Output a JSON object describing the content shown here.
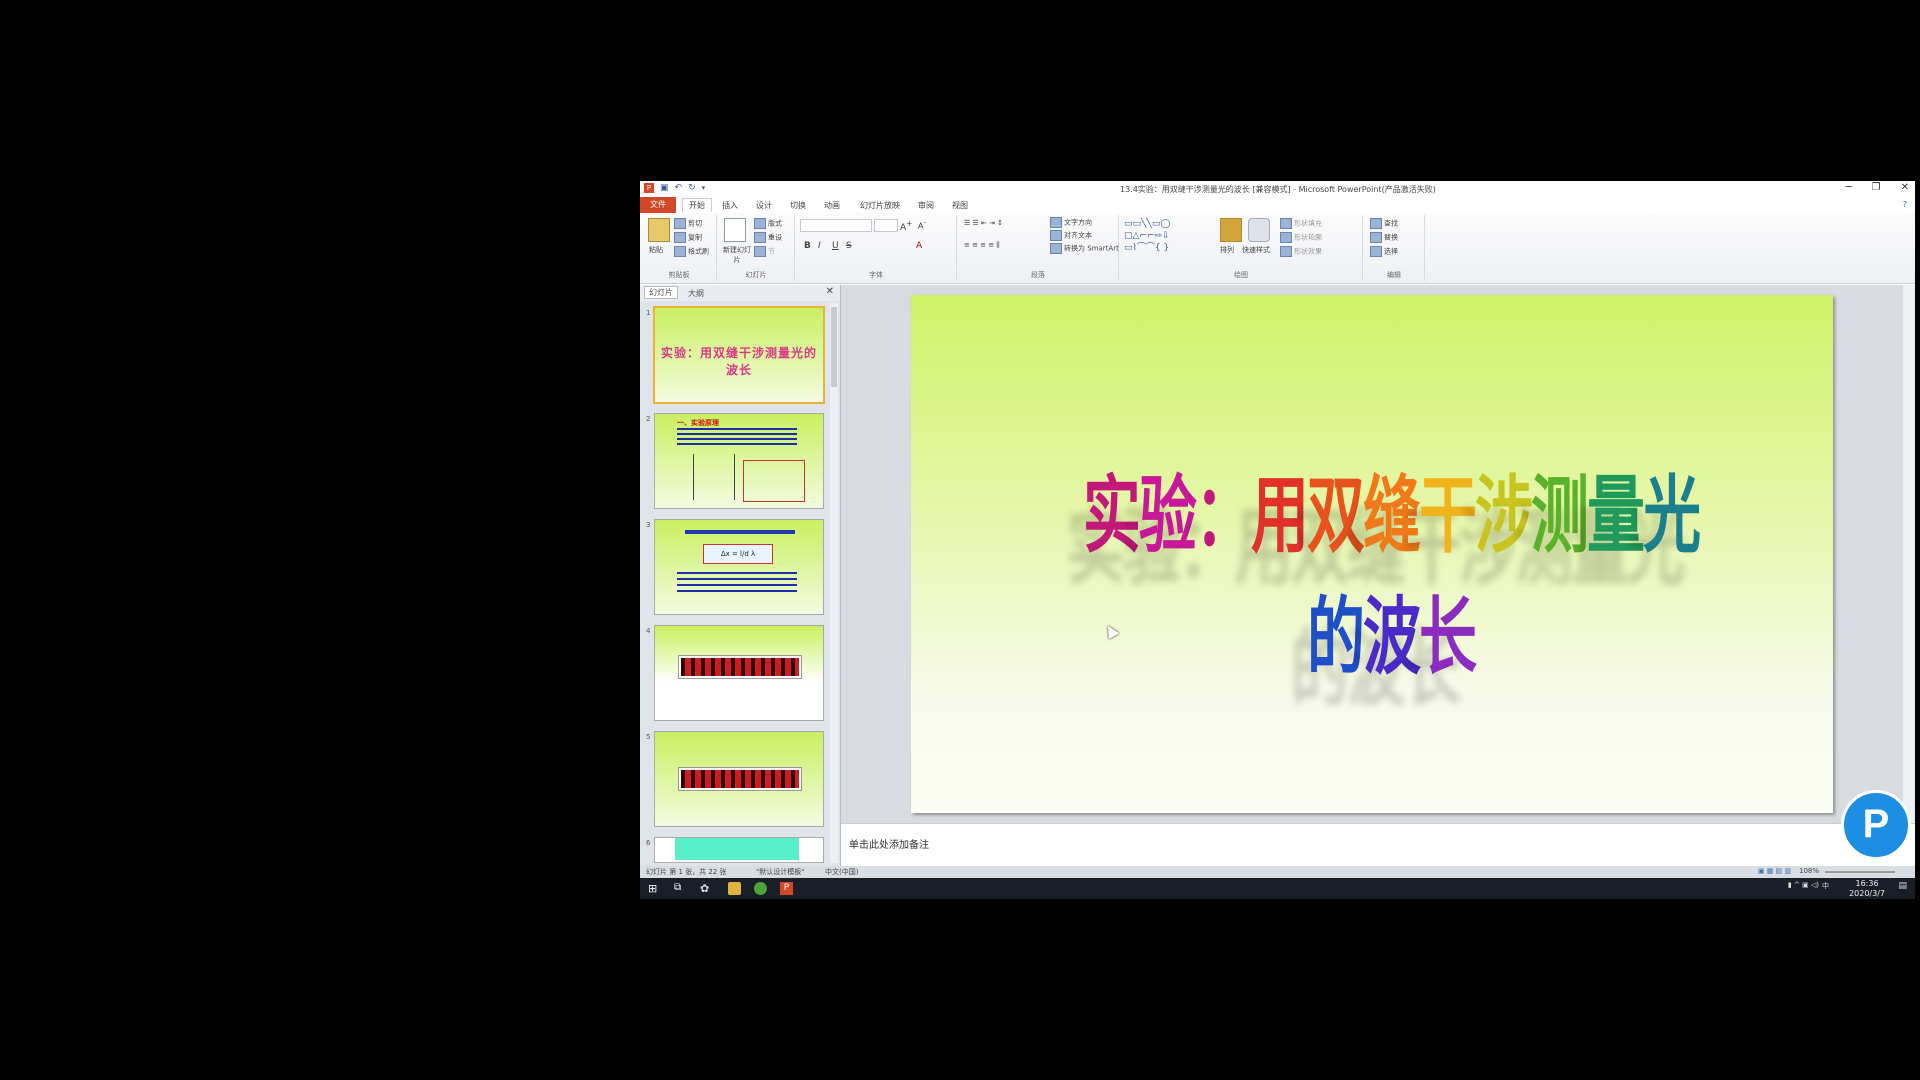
{
  "window": {
    "title": "13.4实验：用双缝干涉测量光的波长 [兼容模式] - Microsoft PowerPoint(产品激活失败)",
    "controls": {
      "minimize": "─",
      "restore": "❐",
      "close": "✕"
    }
  },
  "ribbon_tabs": [
    "文件",
    "开始",
    "插入",
    "设计",
    "切换",
    "动画",
    "幻灯片放映",
    "审阅",
    "视图"
  ],
  "ribbon": {
    "clipboard": {
      "paste": "粘贴",
      "cut": "剪切",
      "copy": "复制",
      "format_painter": "格式刷",
      "label": "剪贴板"
    },
    "slides": {
      "new_slide": "新建幻灯片",
      "layout": "版式",
      "reset": "重设",
      "section": "节",
      "label": "幻灯片"
    },
    "font": {
      "bold": "B",
      "italic": "I",
      "underline": "U",
      "strike": "S",
      "font_color": "A",
      "label": "字体"
    },
    "paragraph": {
      "text_direction": "文字方向",
      "align_text": "对齐文本",
      "smartart": "转换为 SmartArt",
      "label": "段落"
    },
    "drawing": {
      "arrange": "排列",
      "quick_styles": "快速样式",
      "shape_fill": "形状填充",
      "shape_outline": "形状轮廓",
      "shape_effects": "形状效果",
      "label": "绘图"
    },
    "editing": {
      "find": "查找",
      "replace": "替换",
      "select": "选择",
      "label": "编辑"
    }
  },
  "left_pane": {
    "tabs": [
      "幻灯片",
      "大纲"
    ],
    "slide_numbers": [
      "1",
      "2",
      "3",
      "4",
      "5",
      "6"
    ],
    "thumb1_text": "实验：用双缝干涉测量光的波长",
    "thumb2_text": "一、实验原理",
    "thumb3_formula": "Δx = l/d λ"
  },
  "slide": {
    "title_chars": [
      "实",
      "验",
      "：",
      "用",
      "双",
      "缝",
      "干",
      "涉",
      "测",
      "量",
      "光",
      "的",
      "波",
      "长"
    ],
    "title_colors": [
      "#c2187a",
      "#c8189a",
      "#c2187a",
      "#e2302a",
      "#e8521c",
      "#f07a18",
      "#f0b31a",
      "#c8c420",
      "#5ab228",
      "#1f9a5a",
      "#1c7f8c",
      "#2050c8",
      "#4a2bc8",
      "#8b2bc0"
    ]
  },
  "notes": {
    "placeholder": "单击此处添加备注"
  },
  "status": {
    "slide_info": "幻灯片 第 1 张，共 22 张",
    "theme": "\"默认设计模板\"",
    "language": "中文(中国)",
    "zoom": "108%"
  },
  "tray": {
    "time": "16:36",
    "date": "2020/3/7",
    "ime": "中"
  },
  "logo": {
    "letter": "P"
  }
}
